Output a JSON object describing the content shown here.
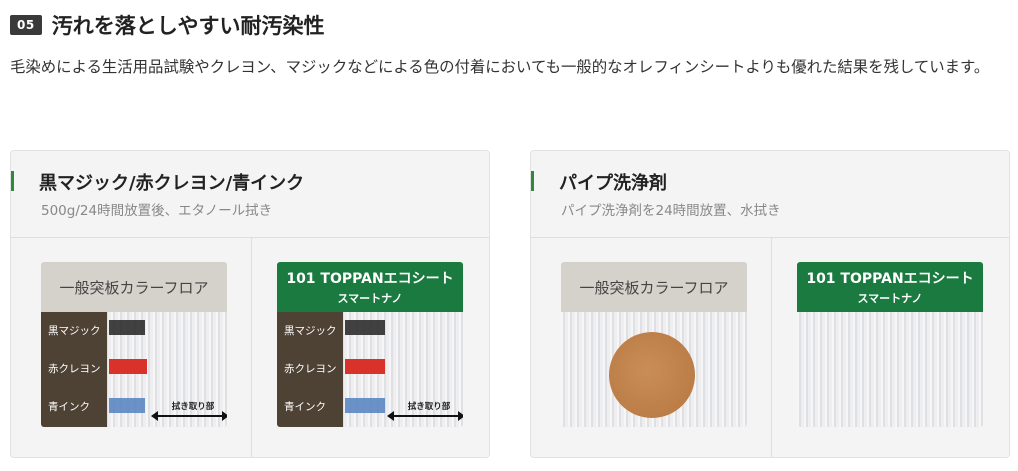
{
  "section": {
    "number": "05",
    "title": "汚れを落としやすい耐汚染性",
    "description": "毛染めによる生活用品試験やクレヨン、マジックなどによる色の付着においても一般的なオレフィンシートよりも優れた結果を残しています。"
  },
  "cards": [
    {
      "title": "黒マジック/赤クレヨン/青インク",
      "subtitle": "500g/24時間放置後、エタノール拭き",
      "samples": [
        {
          "header": "一般突板カラーフロア",
          "stains": [
            "黒マジック",
            "赤クレヨン",
            "青インク"
          ],
          "wipe_label": "拭き取り部"
        },
        {
          "header_line1": "101 TOPPANエコシート",
          "header_line2": "スマートナノ",
          "stains": [
            "黒マジック",
            "赤クレヨン",
            "青インク"
          ],
          "wipe_label": "拭き取り部"
        }
      ]
    },
    {
      "title": "パイプ洗浄剤",
      "subtitle": "パイプ洗浄剤を24時間放置、水拭き",
      "samples": [
        {
          "header": "一般突板カラーフロア"
        },
        {
          "header_line1": "101 TOPPANエコシート",
          "header_line2": "スマートナノ"
        }
      ]
    }
  ],
  "colors": {
    "accent_green": "#2e8b3e",
    "brand_green": "#1a7a3f",
    "label_brown": "#4e4234",
    "badge_dark": "#3a3a3a"
  }
}
